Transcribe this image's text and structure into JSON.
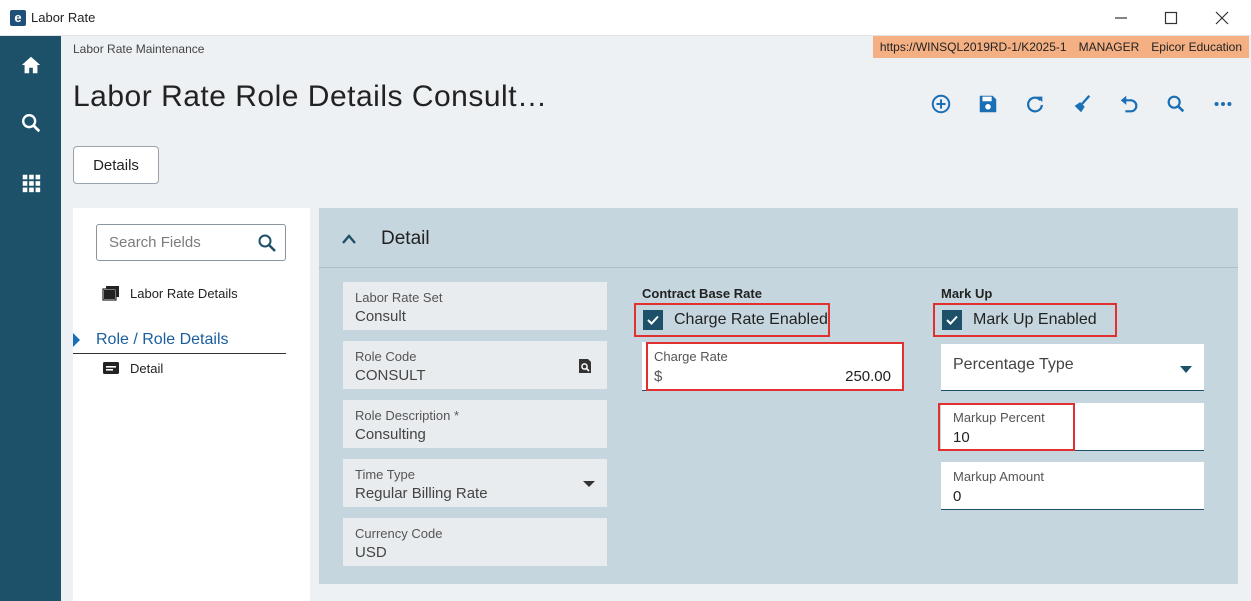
{
  "window": {
    "logo_letter": "e",
    "title": "Labor Rate",
    "minimize_icon": "minimize-icon",
    "maximize_icon": "maximize-icon",
    "close_icon": "close-icon"
  },
  "rail": {
    "items": [
      {
        "name": "home",
        "icon": "home-icon"
      },
      {
        "name": "search",
        "icon": "search-icon"
      },
      {
        "name": "apps",
        "icon": "grid-icon"
      }
    ],
    "color": "#1d5169"
  },
  "breadcrumb": "Labor Rate Maintenance",
  "env": {
    "url": "https://WINSQL2019RD-1/K2025-1",
    "user": "MANAGER",
    "company": "Epicor Education",
    "color": "#f4b083"
  },
  "page_title": "Labor Rate Role Details Consult…",
  "toolbar": {
    "icons": [
      "add-icon",
      "save-icon",
      "refresh-icon",
      "clear-icon",
      "undo-icon",
      "search-icon",
      "more-icon"
    ],
    "accent": "#1b6fb5"
  },
  "tab": {
    "label": "Details"
  },
  "navigator": {
    "search_placeholder": "Search Fields",
    "items": [
      {
        "label": "Labor Rate Details",
        "icon": "cards-icon"
      },
      {
        "label": "Role / Role Details",
        "type": "group",
        "expanded": true
      },
      {
        "label": "Detail",
        "icon": "card-icon"
      }
    ]
  },
  "detail": {
    "title": "Detail",
    "fields": [
      {
        "label": "Labor Rate Set",
        "value": "Consult"
      },
      {
        "label": "Role Code",
        "value": "CONSULT",
        "icon": "lookup-icon"
      },
      {
        "label": "Role Description *",
        "value": "Consulting"
      },
      {
        "label": "Time Type",
        "value": "Regular Billing Rate",
        "dropdown": true
      },
      {
        "label": "Currency Code",
        "value": "USD"
      }
    ],
    "contract_base_rate": {
      "group_label": "Contract Base Rate",
      "checkbox_label": "Charge Rate Enabled",
      "checked": true,
      "charge_rate_label": "Charge Rate",
      "currency_symbol": "$",
      "charge_rate_value": "250.00"
    },
    "mark_up": {
      "group_label": "Mark Up",
      "checkbox_label": "Mark Up Enabled",
      "checked": true,
      "type_value": "Percentage Type",
      "markup_percent_label": "Markup Percent",
      "markup_percent_value": "10",
      "markup_amount_label": "Markup Amount",
      "markup_amount_value": "0"
    }
  },
  "highlight_color": "#e03030"
}
